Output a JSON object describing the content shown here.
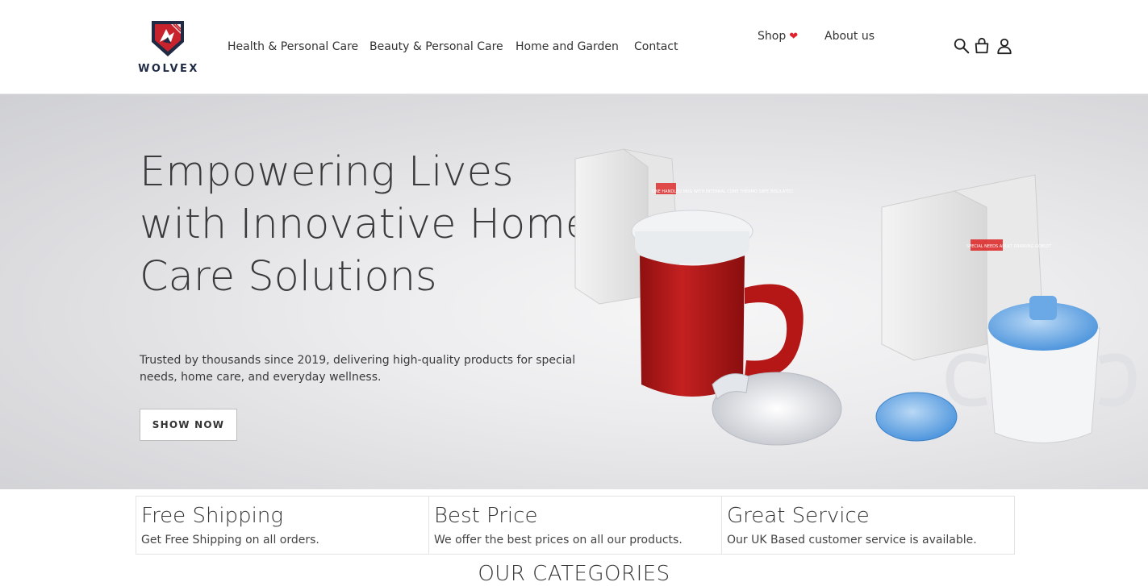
{
  "brand": {
    "name": "WOLVEX",
    "colors": {
      "navy": "#1f2a44",
      "red": "#c8222c",
      "heart": "#e0232f"
    }
  },
  "nav": {
    "links": [
      "Health & Personal Care",
      "Beauty & Personal Care",
      "Home and Garden",
      "Contact"
    ],
    "shop": "Shop",
    "about": "About us"
  },
  "header_icons": [
    "search-icon",
    "bag-icon",
    "user-icon"
  ],
  "hero": {
    "title": "Empowering Lives with Innovative Home Care Solutions",
    "text": "Trusted by thousands since 2019, delivering high-quality products for special needs, home care, and everyday wellness.",
    "button": "SHOW NOW",
    "product_labels": {
      "mug_box": "ONE HANDLED MUG WITH INTERNAL CONE THERMO SAFE INSULATED",
      "goblet_box": "SPECIAL NEEDS ADULT DRINKING GOBLET"
    }
  },
  "features": [
    {
      "title": "Free Shipping",
      "text": "Get Free Shipping on all orders."
    },
    {
      "title": "Best Price",
      "text": "We offer the best prices on all our products."
    },
    {
      "title": "Great Service",
      "text": "Our UK Based customer service is available."
    }
  ],
  "categories_heading": "OUR CATEGORIES"
}
